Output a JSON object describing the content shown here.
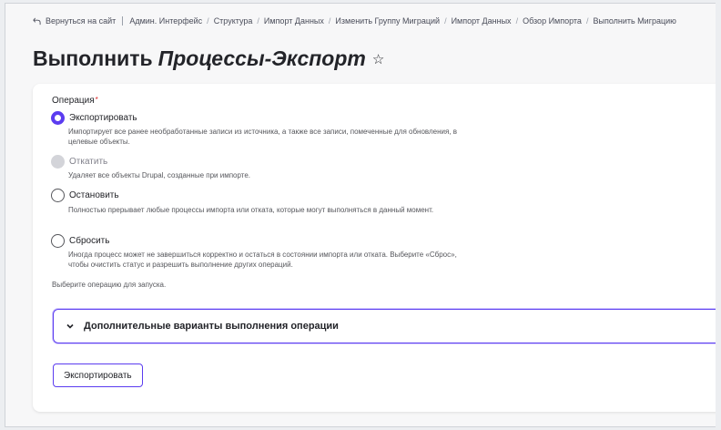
{
  "breadcrumb": {
    "back_label": "Вернуться на сайт",
    "items": [
      "Админ. Интерфейс",
      "Структура",
      "Импорт Данных",
      "Изменить Группу Миграций",
      "Импорт Данных",
      "Обзор Импорта",
      "Выполнить Миграцию"
    ]
  },
  "page": {
    "title_prefix": "Выполнить",
    "title_italic": "Процессы-Экспорт",
    "star": "☆"
  },
  "form": {
    "operation_label": "Операция",
    "required_mark": "*",
    "options": [
      {
        "label": "Экспортировать",
        "description": "Импортирует все ранее необработанные записи из источника, а также все записи, помеченные для обновления, в целевые объекты.",
        "state": "checked"
      },
      {
        "label": "Откатить",
        "description": "Удаляет все объекты Drupal, созданные при импорте.",
        "state": "disabled"
      },
      {
        "label": "Остановить",
        "description": "Полностью прерывает любые процессы импорта или отката, которые могут выполняться в данный момент.",
        "state": "unchecked"
      },
      {
        "label": "Сбросить",
        "description": "Иногда процесс может не завершиться корректно и остаться в состоянии импорта или отката. Выберите «Сброс», чтобы очистить статус и разрешить выполнение других операций.",
        "state": "unchecked"
      }
    ],
    "help_text": "Выберите операцию для запуска.",
    "details_label": "Дополнительные варианты выполнения операции",
    "submit_label": "Экспортировать"
  },
  "colors": {
    "accent": "#5b3cf0",
    "required": "#dc2323"
  }
}
